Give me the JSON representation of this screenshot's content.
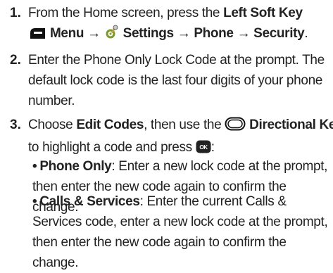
{
  "steps": [
    {
      "number": "1.",
      "line1_prefix": "From the Home screen, press the ",
      "left_soft_key": "Left Soft Key",
      "menu": "Menu",
      "arrow": "→",
      "settings": "Settings",
      "phone": "Phone",
      "security": "Security",
      "period": ".",
      "icons": [
        "left-soft-key-icon",
        "settings-icon"
      ]
    },
    {
      "number": "2.",
      "text": "Enter the Phone Only Lock Code at the prompt. The default lock code is the last four digits of your phone number."
    },
    {
      "number": "3.",
      "choose": "Choose ",
      "edit_codes": "Edit Codes",
      "then_use": ", then use the ",
      "directional_key": "Directional Key",
      "rest": "to highlight a code and press ",
      "ok_label": "OK",
      "colon": ":",
      "icons": [
        "directional-key-icon",
        "ok-key-icon"
      ]
    }
  ],
  "bullets": [
    {
      "label": "Phone Only",
      "text": ": Enter a new lock code at the prompt, then enter the new code again to confirm the change."
    },
    {
      "label": "Calls & Services",
      "text": ": Enter the current Calls & Services code, enter a new lock code at the prompt, then enter the new code again to confirm the change."
    }
  ],
  "bullet_char": "•"
}
